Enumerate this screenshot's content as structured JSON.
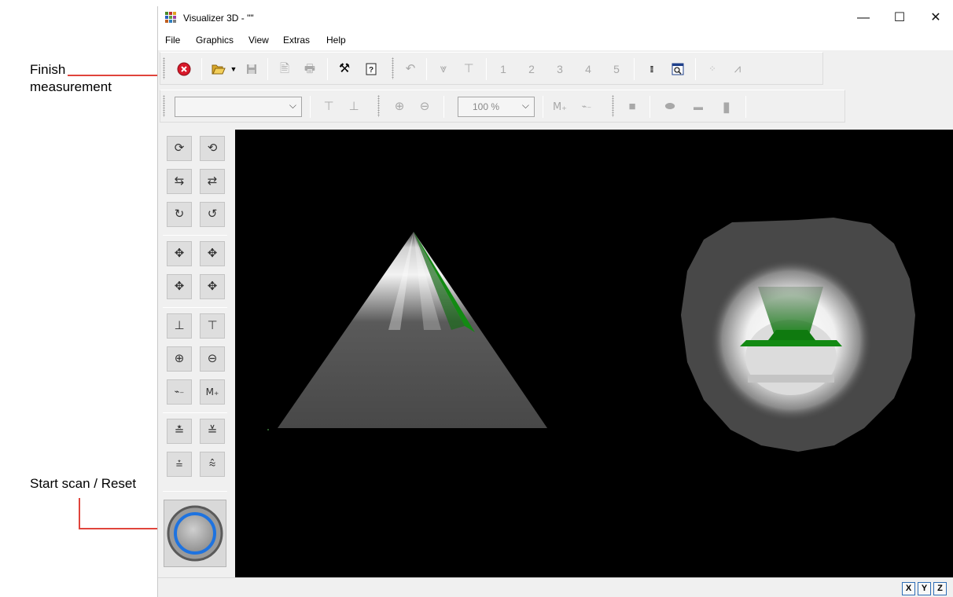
{
  "annotations": {
    "finish": [
      "Finish",
      "measurement"
    ],
    "start": "Start scan / Reset",
    "color": "#e0443c"
  },
  "window": {
    "title": "Visualizer 3D - \"\"",
    "controls": {
      "minimize": "—",
      "maximize": "☐",
      "close": "✕"
    }
  },
  "menu": [
    "File",
    "Graphics",
    "View",
    "Extras",
    "Help"
  ],
  "toolbar1": {
    "finish_icon": "stop-icon",
    "numbers": [
      "1",
      "2",
      "3",
      "4",
      "5"
    ]
  },
  "toolbar2": {
    "dropdown_value": "",
    "zoom_value": "100 %"
  },
  "statusbar": {
    "axes": [
      "X",
      "Y",
      "Z"
    ]
  },
  "colors": {
    "accent_green": "#138a13",
    "shape_gray": "#4a4a4a",
    "highlight": "#f0f0f0",
    "scan_ring": "#1e73e0"
  }
}
